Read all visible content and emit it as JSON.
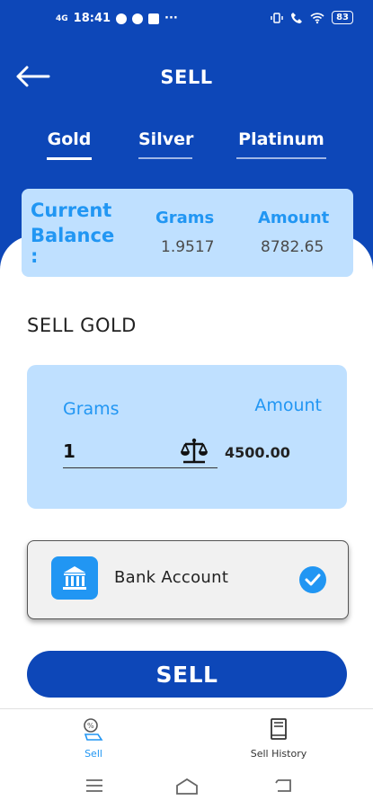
{
  "status_bar": {
    "time": "18:41",
    "network": "4G",
    "more": "···",
    "battery": "83"
  },
  "header": {
    "title": "SELL"
  },
  "tabs": [
    {
      "label": "Gold",
      "active": true
    },
    {
      "label": "Silver",
      "active": false
    },
    {
      "label": "Platinum",
      "active": false
    }
  ],
  "balance": {
    "label_line1": "Current",
    "label_line2": "Balance",
    "label_line3": ":",
    "grams_header": "Grams",
    "grams_value": "1.9517",
    "amount_header": "Amount",
    "amount_value": "8782.65"
  },
  "section": {
    "title": "SELL GOLD"
  },
  "sell_form": {
    "grams_label": "Grams",
    "amount_label": "Amount",
    "grams_value": "1",
    "amount_value": "4500.00",
    "scale_icon": "scale-icon"
  },
  "payout": {
    "label": "Bank Account",
    "selected": true,
    "icon": "bank-icon"
  },
  "actions": {
    "sell_label": "SELL"
  },
  "bottom_nav": [
    {
      "label": "Sell",
      "icon": "sell-icon"
    },
    {
      "label": "Sell History",
      "icon": "history-icon"
    }
  ],
  "colors": {
    "primary": "#0d47b8",
    "accent": "#2196f3",
    "card_bg": "#bfe0ff"
  }
}
